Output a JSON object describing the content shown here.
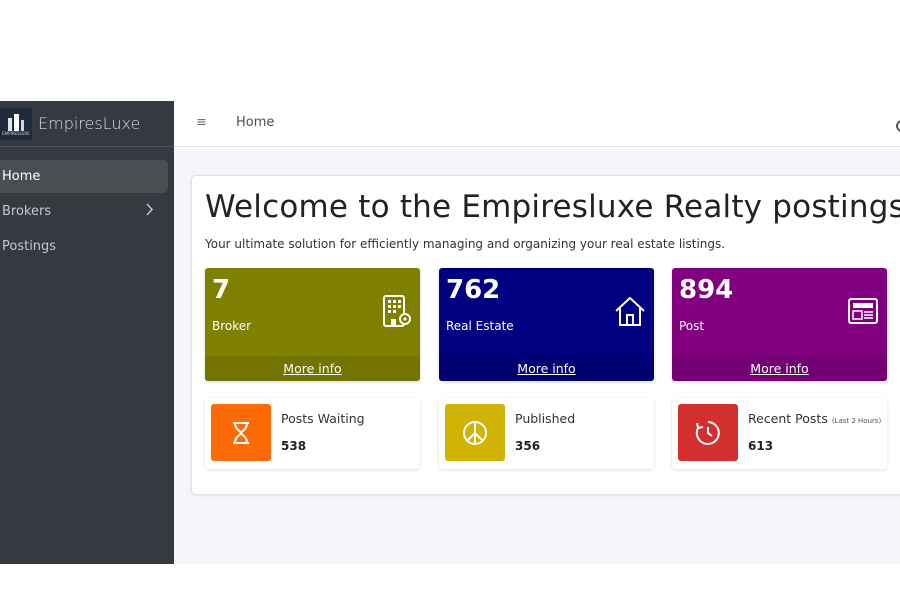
{
  "brand": {
    "name": "EmpiresLuxe",
    "logo_text": "EMPIRESLUXE"
  },
  "sidebar": {
    "items": [
      {
        "label": "Home",
        "active": true
      },
      {
        "label": "Brokers",
        "has_children": true
      },
      {
        "label": "Postings"
      }
    ]
  },
  "topbar": {
    "menu_icon": "≡",
    "breadcrumb": "Home"
  },
  "main": {
    "title": "Welcome to the Empiresluxe Realty postings a",
    "tagline": "Your ultimate solution for efficiently managing and organizing your real estate listings."
  },
  "stats": [
    {
      "value": "7",
      "label": "Broker",
      "link": "More info",
      "icon": "building-gear-icon",
      "color": "#808000"
    },
    {
      "value": "762",
      "label": "Real Estate",
      "link": "More info",
      "icon": "house-icon",
      "color": "#000080"
    },
    {
      "value": "894",
      "label": "Post",
      "link": "More info",
      "icon": "newspaper-icon",
      "color": "#800080"
    }
  ],
  "info": [
    {
      "label": "Posts Waiting",
      "sub": "",
      "value": "538",
      "icon": "hourglass-icon",
      "color": "#fd6a06"
    },
    {
      "label": "Published",
      "sub": "",
      "value": "356",
      "icon": "peace-icon",
      "color": "#d1b305"
    },
    {
      "label": "Recent Posts",
      "sub": "(Last 2 Hours)",
      "value": "613",
      "icon": "clock-icon",
      "color": "#d32f2f"
    }
  ]
}
